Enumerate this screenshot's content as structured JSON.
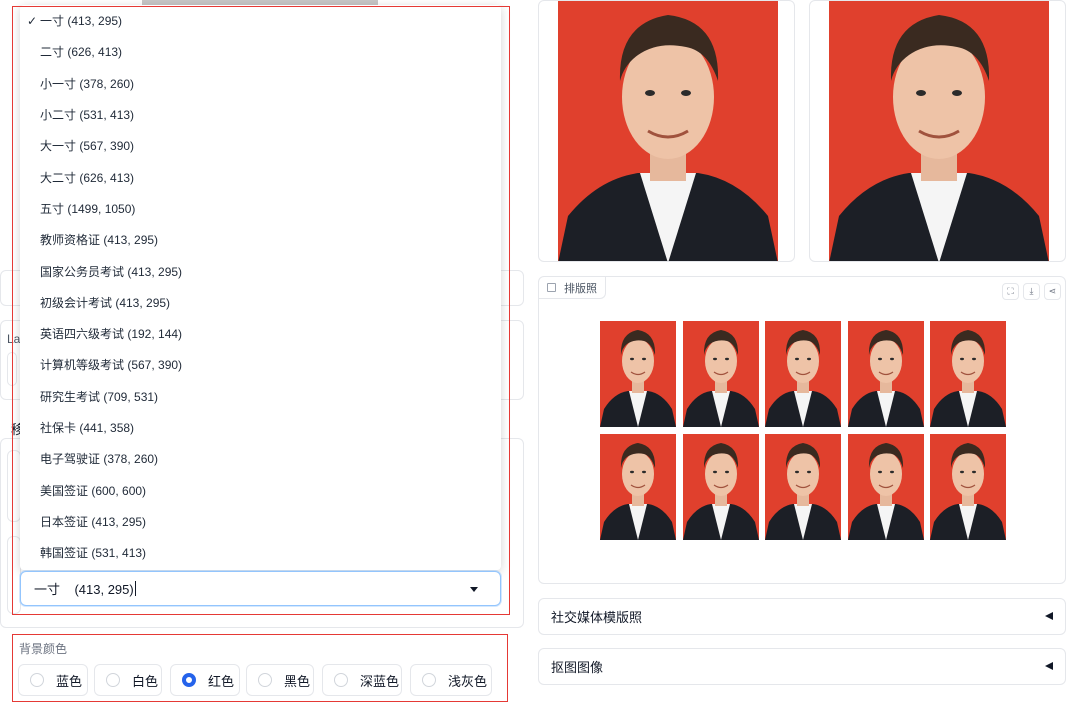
{
  "size_dropdown": {
    "options": [
      "一寸 (413, 295)",
      "二寸 (626, 413)",
      "小一寸 (378, 260)",
      "小二寸 (531, 413)",
      "大一寸 (567, 390)",
      "大二寸 (626, 413)",
      "五寸 (1499, 1050)",
      "教师资格证 (413, 295)",
      "国家公务员考试 (413, 295)",
      "初级会计考试 (413, 295)",
      "英语四六级考试 (192, 144)",
      "计算机等级考试 (567, 390)",
      "研究生考试 (709, 531)",
      "社保卡 (441, 358)",
      "电子驾驶证 (378, 260)",
      "美国签证 (600, 600)",
      "日本签证 (413, 295)",
      "韩国签证 (531, 413)"
    ],
    "check_mark": "✓",
    "selected_value": "一寸    (413, 295)"
  },
  "left_peek": {
    "la": "La",
    "yi": "移"
  },
  "background_color": {
    "label": "背景颜色",
    "options": [
      "蓝色",
      "白色",
      "红色",
      "黑色",
      "深蓝色",
      "浅灰色"
    ],
    "selected": "红色"
  },
  "layout_photo": {
    "label": "排版照",
    "tools": [
      "fullscreen-icon",
      "download-icon",
      "share-icon"
    ]
  },
  "accordions": [
    "社交媒体模版照",
    "抠图图像"
  ],
  "colors": {
    "photo_background": "#e0402d",
    "accent": "#2563eb",
    "highlight_box": "#e53935"
  }
}
